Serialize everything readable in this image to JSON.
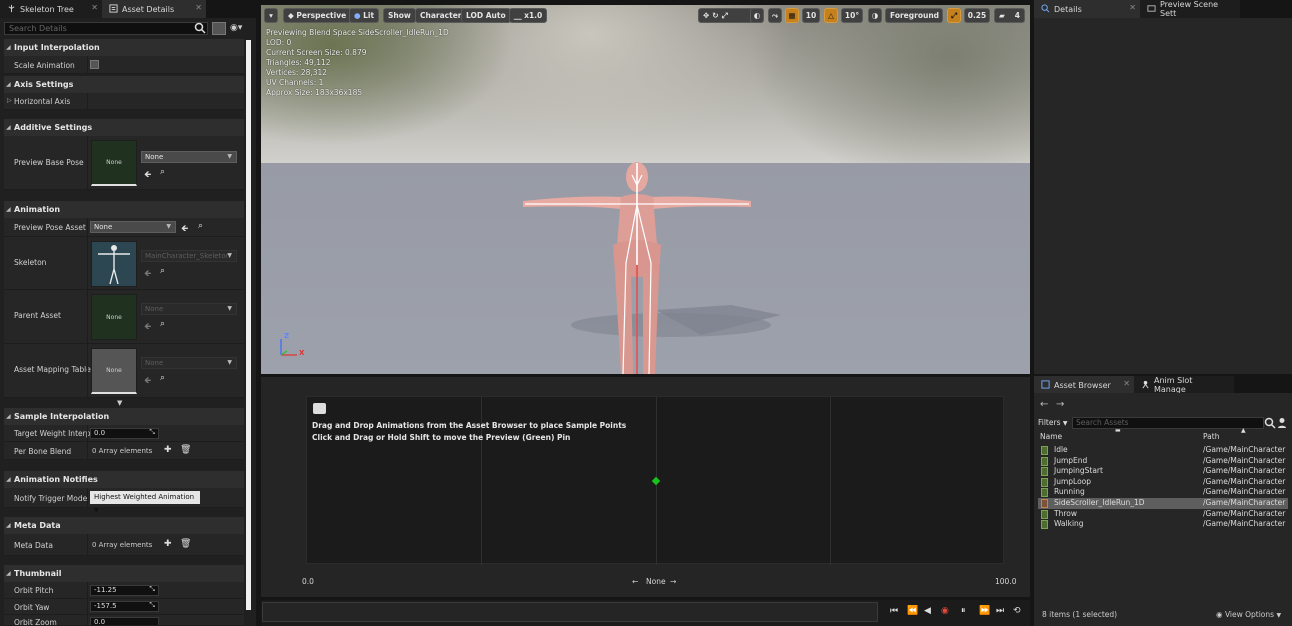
{
  "left_tabs": [
    {
      "label": "Skeleton Tree",
      "active": false
    },
    {
      "label": "Asset Details",
      "active": true
    }
  ],
  "left": {
    "search_placeholder": "Search Details",
    "sections": {
      "input_interpolation": "Input Interpolation",
      "axis_settings": "Axis Settings",
      "additive_settings": "Additive Settings",
      "animation": "Animation",
      "sample_interpolation": "Sample Interpolation",
      "animation_notifies": "Animation Notifies",
      "meta_data": "Meta Data",
      "thumbnail": "Thumbnail"
    },
    "labels": {
      "scale_animation": "Scale Animation",
      "horizontal_axis": "Horizontal Axis",
      "preview_base_pose": "Preview Base Pose",
      "preview_pose_asset": "Preview Pose Asset",
      "skeleton": "Skeleton",
      "parent_asset": "Parent Asset",
      "asset_mapping_table": "Asset Mapping Table",
      "target_weight": "Target Weight Interpo",
      "per_bone_blend": "Per Bone Blend",
      "notify_trigger_mode": "Notify Trigger Mode",
      "meta_data": "Meta Data",
      "orbit_pitch": "Orbit Pitch",
      "orbit_yaw": "Orbit Yaw",
      "orbit_zoom": "Orbit Zoom"
    },
    "values": {
      "thumb_none": "None",
      "base_pose_combo": "None",
      "pose_asset_combo": "None",
      "skeleton_combo": "MainCharacter_Skeleton",
      "parent_combo": "None",
      "mapping_combo": "None",
      "target_weight": "0.0",
      "per_bone_blend": "0 Array elements",
      "notify_trigger_mode": "Highest Weighted Animation",
      "meta_data": "0 Array elements",
      "orbit_pitch": "-11.25",
      "orbit_yaw": "-157.5",
      "orbit_zoom": "0.0"
    }
  },
  "viewport": {
    "buttons": {
      "perspective": "Perspective",
      "lit": "Lit",
      "show": "Show",
      "character": "Character",
      "lod": "LOD Auto",
      "speed": "x1.0",
      "grid_snap": "10",
      "rot_snap": "10°",
      "foreground": "Foreground",
      "scale_snap": "0.25",
      "cam_speed": "4"
    },
    "info": [
      "Previewing Blend Space SideScroller_IdleRun_1D",
      "LOD: 0",
      "Current Screen Size: 0.879",
      "Triangles: 49,112",
      "Vertices: 28,312",
      "UV Channels: 1",
      "Approx Size: 183x36x185"
    ],
    "axis_z": "Z",
    "axis_x": "X"
  },
  "blend": {
    "line1": "Drag and Drop Animations from the Asset Browser to place Sample Points",
    "line2": "Click and Drag or Hold Shift to move the Preview (Green) Pin",
    "min": "0.0",
    "max": "100.0",
    "axis_name": "None"
  },
  "right_tabs": [
    {
      "label": "Details",
      "active": true
    },
    {
      "label": "Preview Scene Sett",
      "active": false
    }
  ],
  "right_bottom_tabs": [
    {
      "label": "Asset Browser",
      "active": true
    },
    {
      "label": "Anim Slot Manage",
      "active": false
    }
  ],
  "browser": {
    "filters": "Filters",
    "search_placeholder": "Search Assets",
    "col_name": "Name",
    "col_path": "Path",
    "assets": [
      {
        "name": "Idle",
        "path": "/Game/MainCharacter",
        "type": "anim",
        "selected": false
      },
      {
        "name": "JumpEnd",
        "path": "/Game/MainCharacter",
        "type": "anim",
        "selected": false
      },
      {
        "name": "JumpingStart",
        "path": "/Game/MainCharacter",
        "type": "anim",
        "selected": false
      },
      {
        "name": "JumpLoop",
        "path": "/Game/MainCharacter",
        "type": "anim",
        "selected": false
      },
      {
        "name": "Running",
        "path": "/Game/MainCharacter",
        "type": "anim",
        "selected": false
      },
      {
        "name": "SideScroller_IdleRun_1D",
        "path": "/Game/MainCharacter",
        "type": "blendspace",
        "selected": true
      },
      {
        "name": "Throw",
        "path": "/Game/MainCharacter",
        "type": "anim",
        "selected": false
      },
      {
        "name": "Walking",
        "path": "/Game/MainCharacter",
        "type": "anim",
        "selected": false
      }
    ],
    "count": "8 items (1 selected)",
    "view_options": "View Options"
  },
  "colors": {
    "accent_orange": "#c6811f",
    "preview_pin": "#19c31b",
    "selection": "#5e5e5e"
  }
}
